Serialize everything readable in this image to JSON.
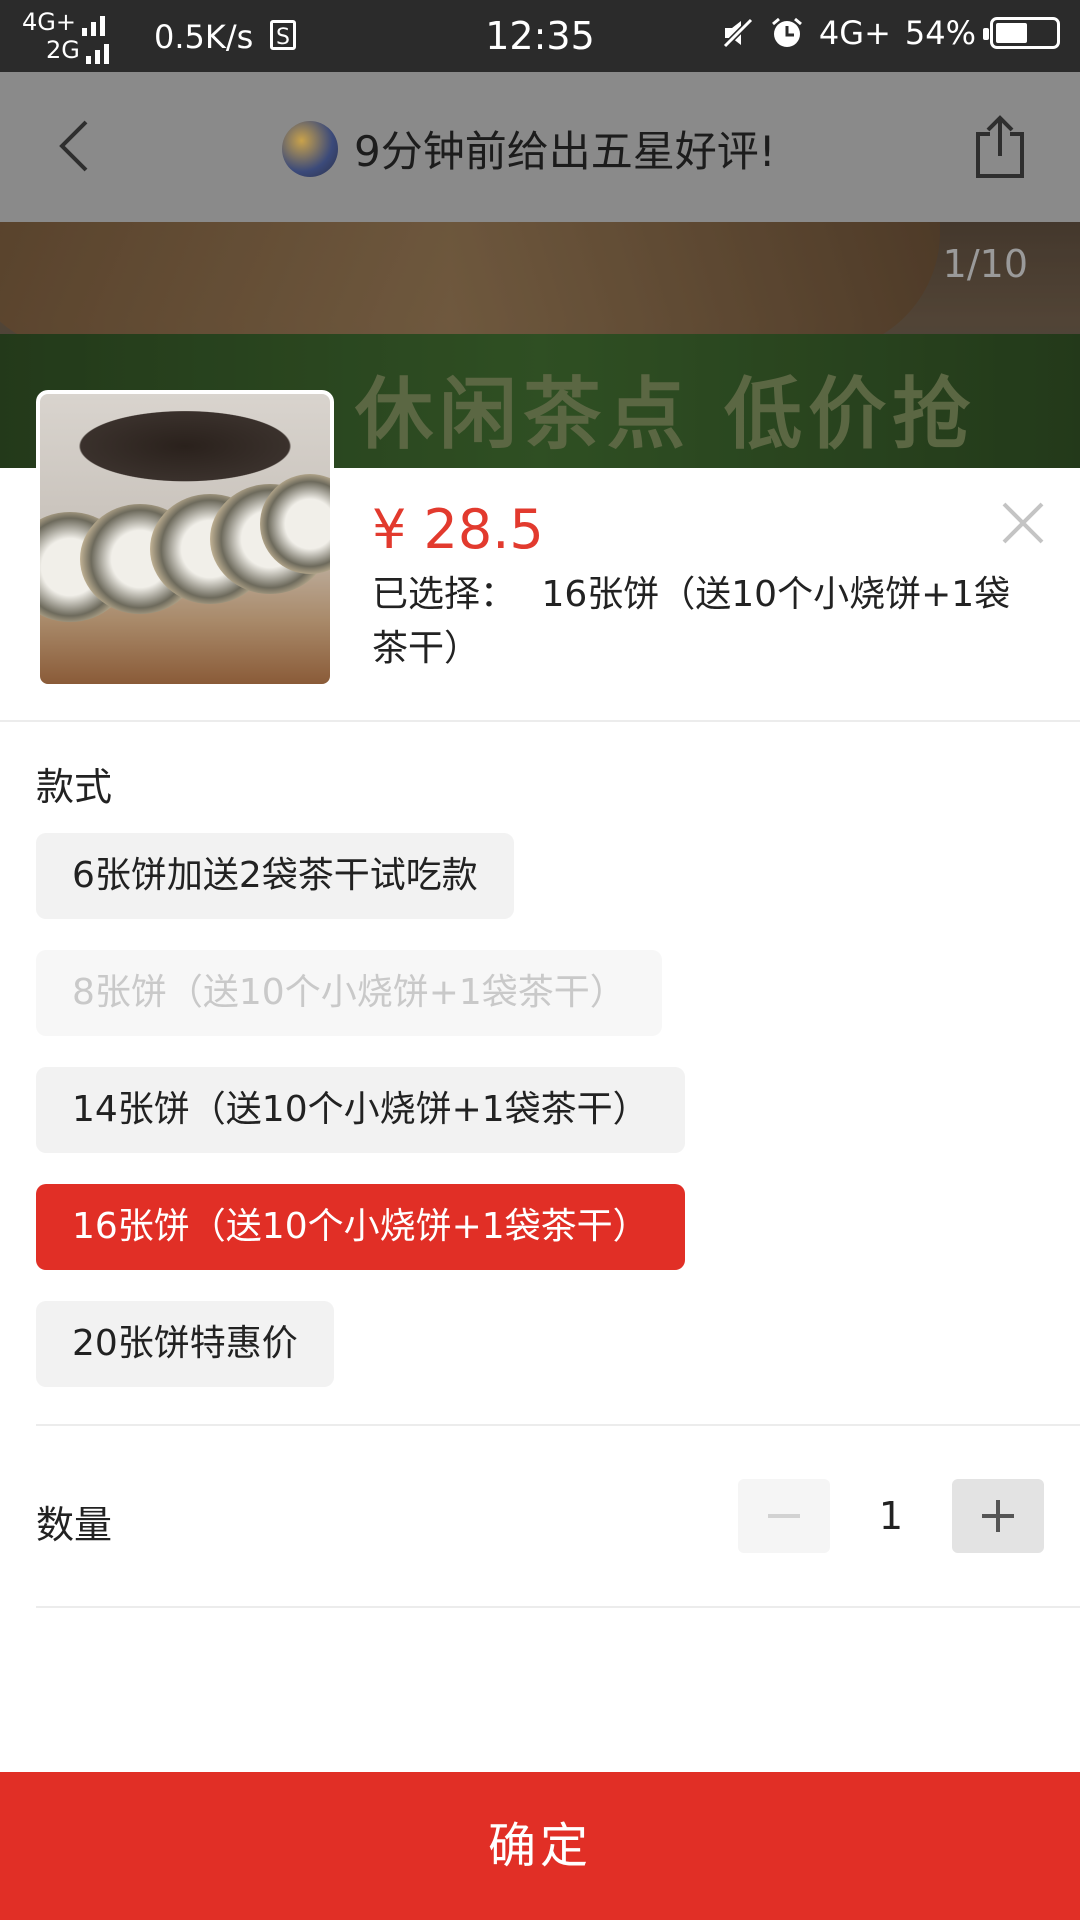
{
  "status_bar": {
    "network_top": "4G+",
    "network_bottom": "2G",
    "speed": "0.5K/s",
    "sim_icon": "S",
    "time": "12:35",
    "network_right": "4G+",
    "battery_percent": "54%",
    "battery_level": 0.54
  },
  "header": {
    "title": "9分钟前给出五星好评!"
  },
  "banner": {
    "page_counter": "1/10",
    "promo_text": "休闲茶点 低价抢"
  },
  "product": {
    "price": "¥ 28.5",
    "selected_label": "已选择：",
    "selected_value": "16张饼（送10个小烧饼+1袋茶干）"
  },
  "style_section": {
    "label": "款式",
    "options": [
      {
        "label": "6张饼加送2袋茶干试吃款",
        "state": "normal"
      },
      {
        "label": "8张饼（送10个小烧饼+1袋茶干）",
        "state": "disabled"
      },
      {
        "label": "14张饼（送10个小烧饼+1袋茶干）",
        "state": "normal"
      },
      {
        "label": "16张饼（送10个小烧饼+1袋茶干）",
        "state": "selected"
      },
      {
        "label": "20张饼特惠价",
        "state": "normal"
      }
    ]
  },
  "quantity": {
    "label": "数量",
    "value": "1"
  },
  "confirm": {
    "label": "确定"
  },
  "colors": {
    "accent": "#e12f26",
    "price": "#e23a2e"
  }
}
